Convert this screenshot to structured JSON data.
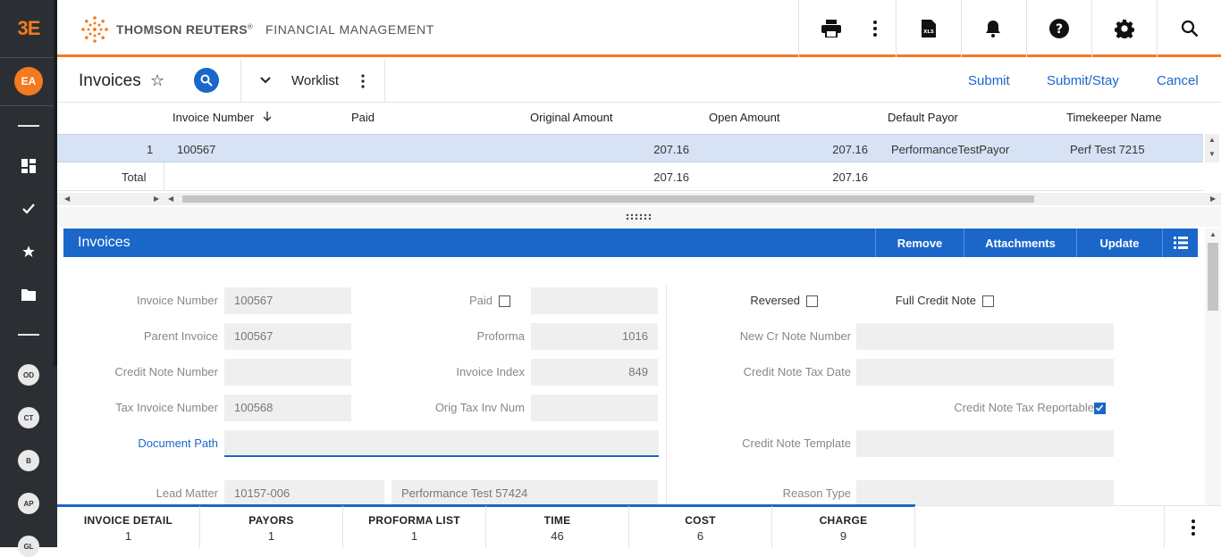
{
  "app": {
    "logo": "3E",
    "brand_name": "THOMSON REUTERS",
    "brand_mark": "®",
    "brand_sub": "FINANCIAL MANAGEMENT",
    "accent": "#f47a20",
    "primary": "#1a66c9"
  },
  "rail": {
    "avatar": "EA",
    "shortcuts": [
      "OD",
      "CT",
      "B",
      "AP",
      "GL"
    ]
  },
  "page": {
    "title": "Invoices",
    "worklist": "Worklist",
    "actions": {
      "submit": "Submit",
      "submit_stay": "Submit/Stay",
      "cancel": "Cancel"
    }
  },
  "grid": {
    "columns": [
      "Invoice Number",
      "Paid",
      "Original Amount",
      "Open Amount",
      "Default Payor",
      "Timekeeper Name"
    ],
    "rows": [
      {
        "index": "1",
        "invoice_number": "100567",
        "paid": "",
        "original_amount": "207.16",
        "open_amount": "207.16",
        "default_payor": "PerformanceTestPayor",
        "timekeeper_name": "Perf Test 7215"
      }
    ],
    "total": {
      "label": "Total",
      "original_amount": "207.16",
      "open_amount": "207.16"
    }
  },
  "panel": {
    "title": "Invoices",
    "buttons": {
      "remove": "Remove",
      "attachments": "Attachments",
      "update": "Update"
    },
    "fields": {
      "invoice_number": {
        "label": "Invoice Number",
        "value": "100567"
      },
      "parent_invoice": {
        "label": "Parent Invoice",
        "value": "100567"
      },
      "credit_note_number": {
        "label": "Credit Note Number",
        "value": ""
      },
      "tax_invoice_number": {
        "label": "Tax Invoice Number",
        "value": "100568"
      },
      "document_path": {
        "label": "Document Path",
        "value": ""
      },
      "lead_matter": {
        "label": "Lead Matter",
        "value": "10157-006",
        "description": "Performance Test 57424"
      },
      "paid": {
        "label": "Paid",
        "checked": false,
        "value": ""
      },
      "proforma": {
        "label": "Proforma",
        "value": "1016"
      },
      "invoice_index": {
        "label": "Invoice Index",
        "value": "849"
      },
      "orig_tax_inv_num": {
        "label": "Orig Tax Inv Num",
        "value": ""
      },
      "reversed": {
        "label": "Reversed",
        "checked": false
      },
      "full_credit_note": {
        "label": "Full Credit Note",
        "checked": false
      },
      "new_cr_note_number": {
        "label": "New Cr Note Number",
        "value": ""
      },
      "credit_note_tax_date": {
        "label": "Credit Note Tax Date",
        "value": ""
      },
      "credit_note_tax_reportable": {
        "label": "Credit Note Tax Reportable",
        "checked": true
      },
      "credit_note_template": {
        "label": "Credit Note Template",
        "value": ""
      },
      "reason_type": {
        "label": "Reason Type",
        "value": ""
      }
    }
  },
  "bottom_tabs": [
    {
      "label": "INVOICE DETAIL",
      "count": "1"
    },
    {
      "label": "PAYORS",
      "count": "1"
    },
    {
      "label": "PROFORMA LIST",
      "count": "1"
    },
    {
      "label": "TIME",
      "count": "46"
    },
    {
      "label": "COST",
      "count": "6"
    },
    {
      "label": "CHARGE",
      "count": "9"
    }
  ],
  "icons": [
    "print-icon",
    "kebab-icon",
    "xls-icon",
    "bell-icon",
    "help-icon",
    "gear-icon",
    "search-icon",
    "star-icon",
    "chevron-down-icon",
    "list-view-icon",
    "drag-handle-icon",
    "sort-down-icon"
  ]
}
